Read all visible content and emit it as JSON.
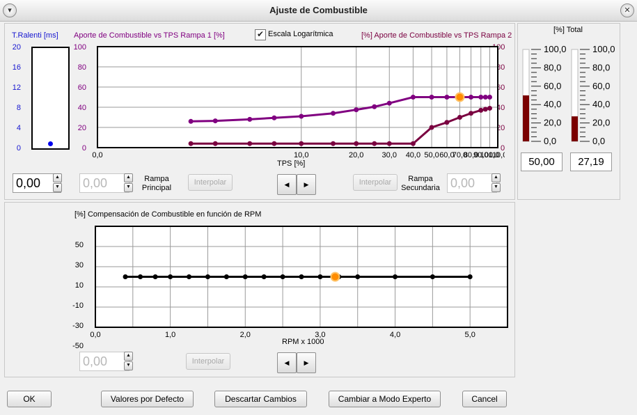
{
  "window": {
    "title": "Ajuste de Combustible"
  },
  "tps_section": {
    "ralenti": {
      "label": "T.Ralenti [ms]",
      "ticks": [
        "20",
        "16",
        "12",
        "8",
        "4",
        "0"
      ],
      "value": 0.9
    },
    "left_title": "Aporte de Combustible vs TPS Rampa 1 [%]",
    "right_title": "[%] Aporte de Combustible vs TPS Rampa 2",
    "log_checkbox": {
      "label": "Escala Logarítmica",
      "checked": true
    },
    "ticks_left": [
      "100",
      "80",
      "60",
      "40",
      "20",
      "0"
    ],
    "ticks_right": [
      "100",
      "80",
      "60",
      "40",
      "20",
      "0"
    ],
    "xaxis_label": "TPS [%]",
    "spin_ralenti": "0,00",
    "spin_principal": "0,00",
    "rampa_principal_label": [
      "Rampa",
      "Principal"
    ],
    "interpolar1": "Interpolar",
    "interpolar2": "Interpolar",
    "rampa_secundaria_label": [
      "Rampa",
      "Secundaria"
    ],
    "spin_secundaria": "0,00",
    "nav_prev": "◀",
    "nav_next": "▶"
  },
  "total_section": {
    "title": "[%] Total",
    "ticks": [
      "100,0",
      "80,0",
      "60,0",
      "40,0",
      "20,0",
      "0,0"
    ],
    "values": [
      "50,00",
      "27,19"
    ],
    "levels": [
      50.0,
      27.19
    ],
    "bar_color": "#7a0000"
  },
  "rpm_section": {
    "title": "[%] Compensación de Combustible en función de RPM",
    "ticks_y": [
      "50",
      "30",
      "10",
      "-10",
      "-30",
      "-50"
    ],
    "xaxis_label": "RPM x 1000",
    "spin_value": "0,00",
    "interpolar": "Interpolar",
    "nav_prev": "◀",
    "nav_next": "▶"
  },
  "footer": {
    "ok": "OK",
    "defaults": "Valores por Defecto",
    "discard": "Descartar Cambios",
    "expert": "Cambiar a Modo Experto",
    "cancel": "Cancel"
  },
  "chart_data": [
    {
      "type": "line",
      "xlabel": "TPS [%]",
      "log_x": true,
      "xlim": [
        0,
        110
      ],
      "ylim": [
        0,
        100
      ],
      "x_ticks": [
        "0,0",
        "10,0",
        "20,0",
        "30,0",
        "40,0",
        "50,0",
        "60,0",
        "70,0",
        "80,0",
        "90,0",
        "100,0",
        "110,0"
      ],
      "series": [
        {
          "name": "Aporte de Combustible vs TPS Rampa 1 [%]",
          "color": "#800080",
          "x": [
            2,
            3,
            5,
            7,
            10,
            15,
            20,
            25,
            30,
            40,
            50,
            60,
            70,
            80,
            90,
            95,
            100
          ],
          "y": [
            26,
            26.5,
            28,
            29.5,
            31,
            34,
            37.5,
            40.5,
            44,
            50,
            50,
            50,
            50,
            50,
            50,
            50,
            50
          ]
        },
        {
          "name": "[%] Aporte de Combustible vs TPS Rampa 2",
          "color": "#7a0040",
          "x": [
            2,
            3,
            5,
            7,
            10,
            15,
            20,
            25,
            30,
            40,
            50,
            60,
            70,
            80,
            90,
            95,
            100
          ],
          "y": [
            4,
            4,
            4,
            4,
            4,
            4,
            4,
            4,
            4,
            4,
            20,
            25,
            30,
            34,
            37,
            38,
            39
          ]
        }
      ],
      "marker": {
        "x": 70,
        "y": 50,
        "color": "#ff8c00"
      }
    },
    {
      "type": "line",
      "xlabel": "RPM x 1000",
      "xlim": [
        0,
        5.5
      ],
      "ylim": [
        -50,
        50
      ],
      "x_ticks": [
        "0,0",
        "1,0",
        "2,0",
        "3,0",
        "4,0",
        "5,0"
      ],
      "series": [
        {
          "name": "[%] Compensación de Combustible en función de RPM",
          "color": "#000000",
          "x": [
            0.4,
            0.6,
            0.8,
            1.0,
            1.25,
            1.5,
            1.75,
            2.0,
            2.25,
            2.5,
            2.75,
            3.0,
            3.25,
            3.5,
            4.0,
            4.5,
            5.0
          ],
          "y": [
            0,
            0,
            0,
            0,
            0,
            0,
            0,
            0,
            0,
            0,
            0,
            0,
            0,
            0,
            0,
            0,
            0
          ]
        }
      ],
      "marker": {
        "x": 3.2,
        "y": 0,
        "color": "#ff8c00"
      }
    }
  ]
}
